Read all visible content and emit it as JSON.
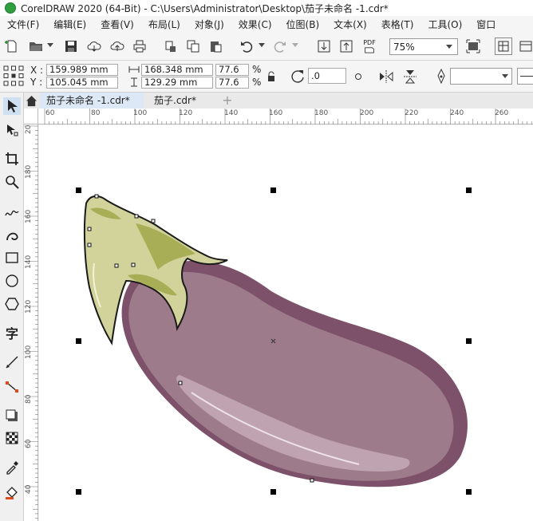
{
  "titlebar": {
    "title": "CorelDRAW 2020 (64-Bit) - C:\\Users\\Administrator\\Desktop\\茄子未命名 -1.cdr*"
  },
  "menu": [
    "文件(F)",
    "编辑(E)",
    "查看(V)",
    "布局(L)",
    "对象(J)",
    "效果(C)",
    "位图(B)",
    "文本(X)",
    "表格(T)",
    "工具(O)",
    "窗口"
  ],
  "toolbar": {
    "pdf_label": "PDF",
    "zoom": "75%"
  },
  "properties": {
    "x_label": "X :",
    "y_label": "Y :",
    "x": "159.989 mm",
    "y": "105.045 mm",
    "width": "168.348 mm",
    "height": "129.29 mm",
    "scale_w": "77.6",
    "scale_h": "77.6",
    "percent": "%",
    "rotation": ".0"
  },
  "tabs": [
    "茄子未命名 -1.cdr*",
    "茄子.cdr*"
  ],
  "rulers": {
    "h": [
      "60",
      "80",
      "100",
      "120",
      "140",
      "160",
      "180",
      "200",
      "220",
      "240",
      "260"
    ],
    "v": [
      "180",
      "160",
      "140",
      "120",
      "100",
      "80",
      "60",
      "40"
    ],
    "v_top": "20"
  },
  "tools": {
    "text_tool_glyph": "字"
  },
  "colors": {
    "eggplant_body": "#9e7b8a",
    "eggplant_shadow": "#7d5169",
    "calyx": "#d2d39a",
    "calyx_dark": "#a8ae55",
    "active_tab": "#dce8f5"
  }
}
